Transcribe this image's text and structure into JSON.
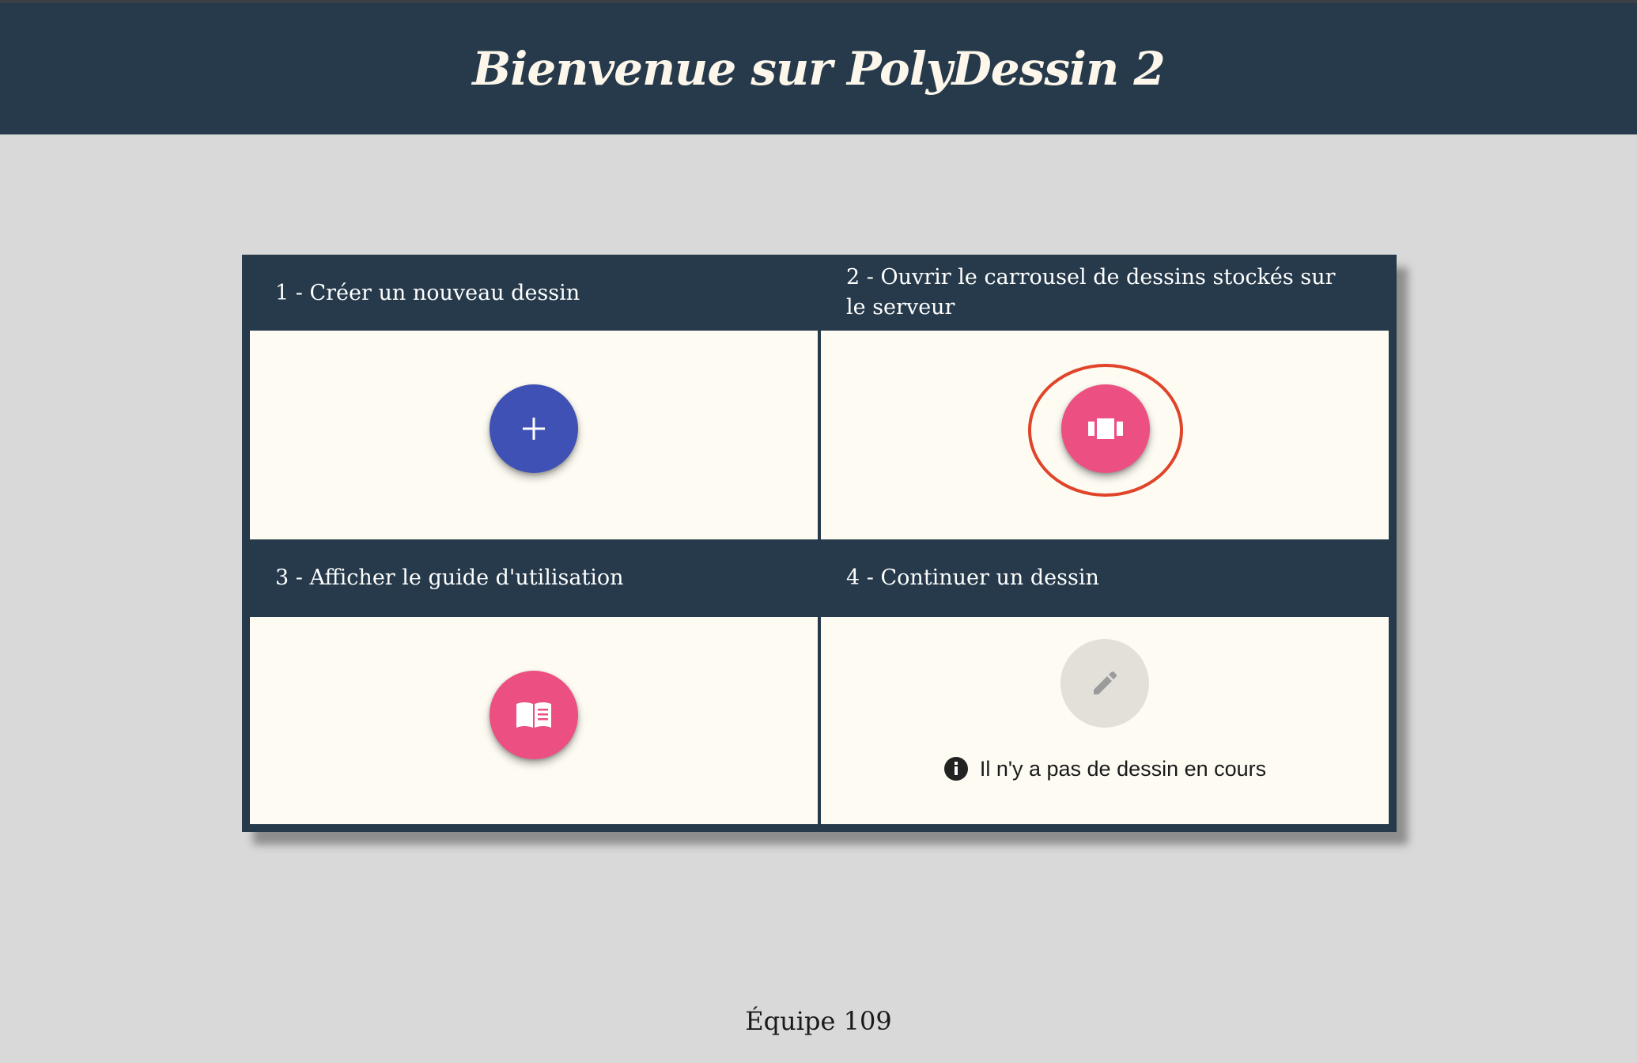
{
  "header": {
    "title": "Bienvenue sur PolyDessin 2"
  },
  "cards": [
    {
      "heading": "1 - Créer un nouveau dessin",
      "button_color": "#3f51b5",
      "icon": "plus-icon"
    },
    {
      "heading": "2 - Ouvrir le carrousel de dessins stockés sur le serveur",
      "button_color": "#ec4f82",
      "icon": "carousel-icon",
      "highlight_color": "#e0442a"
    },
    {
      "heading": "3 - Afficher le guide d'utilisation",
      "button_color": "#ec4f82",
      "icon": "book-icon"
    },
    {
      "heading": "4 - Continuer un dessin",
      "button_color": "#e3e0d9",
      "icon": "pencil-icon",
      "disabled": true,
      "info_text": "Il n'y a pas de dessin en cours",
      "info_icon": "info-icon"
    }
  ],
  "footer": {
    "text": "Équipe 109"
  },
  "colors": {
    "header_bg": "#263a4b",
    "page_bg": "#d9d9d9",
    "card_bg": "#fdfbf2"
  }
}
